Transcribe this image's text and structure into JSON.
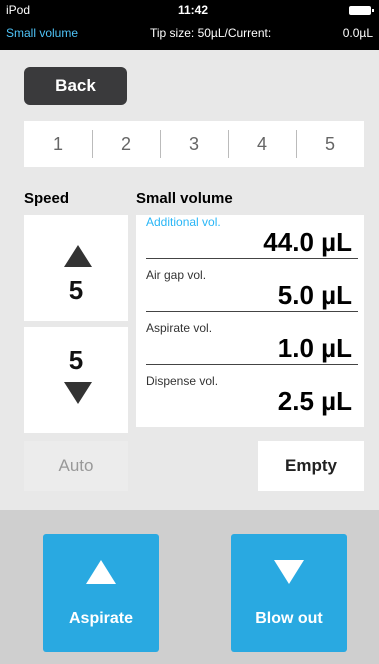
{
  "status": {
    "device": "iPod",
    "time": "11:42",
    "mode": "Small volume",
    "tip_size": "Tip size:   50µL/Current:",
    "current": "0.0µL",
    "battery_icon": "battery-icon"
  },
  "toolbar": {
    "back_label": "Back"
  },
  "tabs": [
    "1",
    "2",
    "3",
    "4",
    "5"
  ],
  "speed": {
    "label": "Speed",
    "up_value": "5",
    "down_value": "5"
  },
  "small_volume": {
    "label": "Small volume",
    "rows": [
      {
        "label": "Additional vol.",
        "value": "44.0 µL"
      },
      {
        "label": "Air gap vol.",
        "value": "5.0 µL"
      },
      {
        "label": "Aspirate vol.",
        "value": "1.0 µL"
      },
      {
        "label": "Dispense vol.",
        "value": "2.5 µL"
      }
    ]
  },
  "buttons": {
    "auto": "Auto",
    "empty": "Empty",
    "aspirate": "Aspirate",
    "blowout": "Blow out"
  },
  "colors": {
    "accent": "#29a9e1",
    "label_accent": "#29b6f6",
    "status_bar": "#000000"
  }
}
